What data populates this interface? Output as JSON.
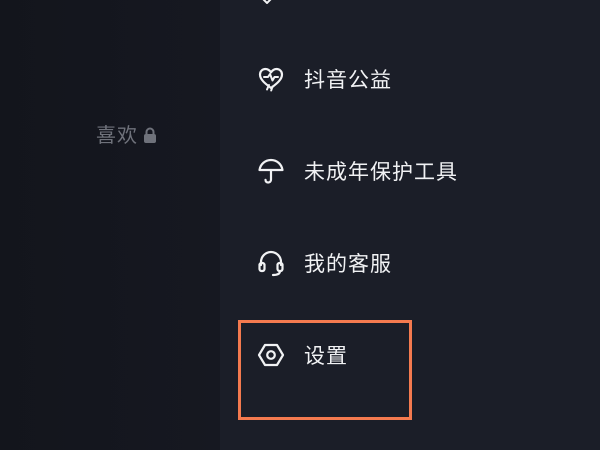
{
  "left_panel": {
    "likes_tab_label": "喜欢"
  },
  "menu": {
    "items": [
      {
        "id": "charity",
        "label": "抖音公益",
        "icon": "heart-pulse-icon"
      },
      {
        "id": "minor-protection",
        "label": "未成年保护工具",
        "icon": "umbrella-icon"
      },
      {
        "id": "customer-service",
        "label": "我的客服",
        "icon": "headset-icon"
      },
      {
        "id": "settings",
        "label": "设置",
        "icon": "hexagon-gear-icon"
      }
    ]
  },
  "highlight": {
    "target": "settings",
    "color": "#f47a4f"
  },
  "colors": {
    "background": "#161922",
    "drawer_background": "#1b1e28",
    "text_primary": "#f1f2f4",
    "text_muted": "#6f727b"
  }
}
